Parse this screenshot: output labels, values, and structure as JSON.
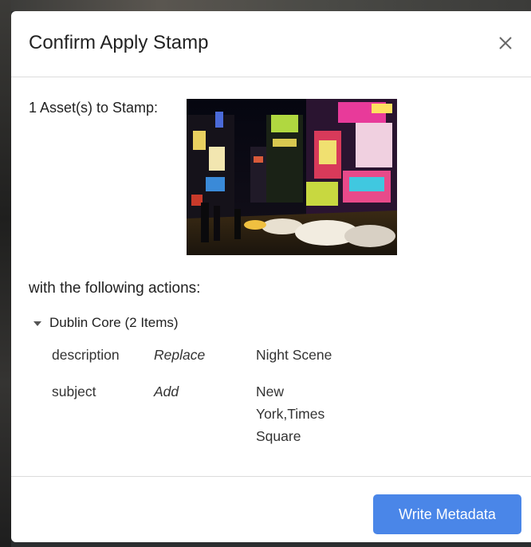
{
  "dialog": {
    "title": "Confirm Apply Stamp",
    "close_icon": "close-icon"
  },
  "asset": {
    "label": "1 Asset(s) to Stamp:",
    "thumbnail_alt": "Night city street scene"
  },
  "actions": {
    "label": "with the following actions:",
    "group": {
      "caret_icon": "caret-down-icon",
      "label": "Dublin Core (2 Items)",
      "rows": [
        {
          "field": "description",
          "operation": "Replace",
          "value": "Night Scene"
        },
        {
          "field": "subject",
          "operation": "Add",
          "value": "New York,Times Square"
        }
      ]
    }
  },
  "footer": {
    "primary_label": "Write Metadata"
  },
  "colors": {
    "primary": "#4a86e8",
    "divider": "#dcdcdc"
  }
}
